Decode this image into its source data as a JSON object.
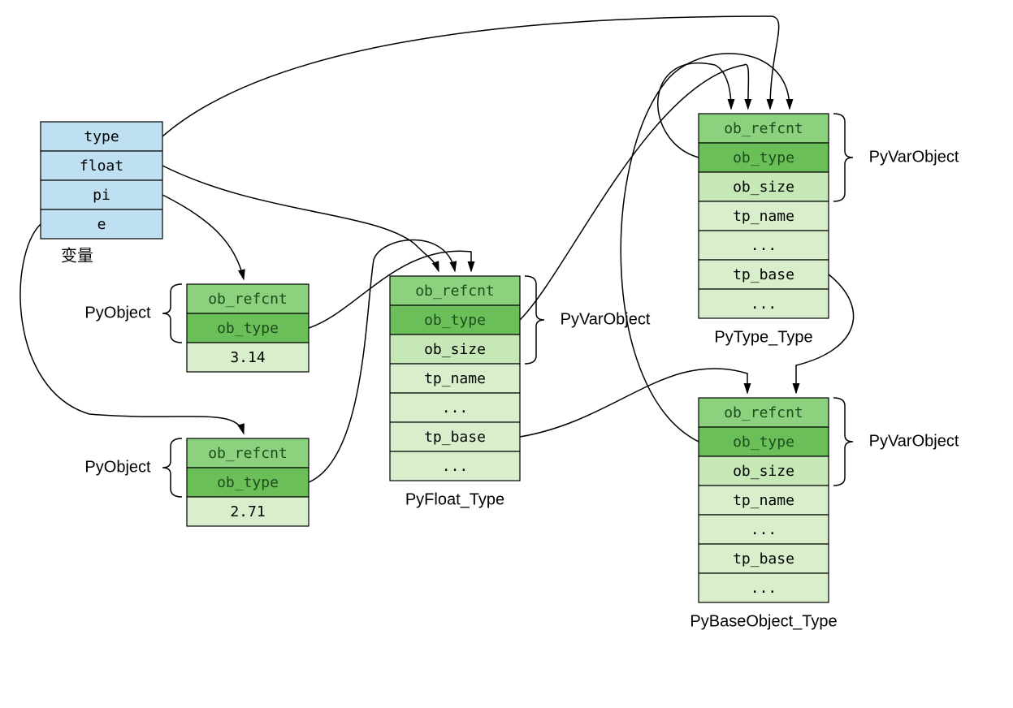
{
  "colors": {
    "blue": "#bfe0f2",
    "greenDark": "#6bbf59",
    "greenMid": "#8cd17d",
    "greenLight": "#c6e8b7",
    "greenPale": "#d9efcc"
  },
  "variables": {
    "title": "变量",
    "rows": [
      "type",
      "float",
      "pi",
      "e"
    ]
  },
  "pi_obj": {
    "rows": [
      "ob_refcnt",
      "ob_type",
      "3.14"
    ],
    "brace_label": "PyObject"
  },
  "e_obj": {
    "rows": [
      "ob_refcnt",
      "ob_type",
      "2.71"
    ],
    "brace_label": "PyObject"
  },
  "pyfloat": {
    "title": "PyFloat_Type",
    "rows": [
      "ob_refcnt",
      "ob_type",
      "ob_size",
      "tp_name",
      "...",
      "tp_base",
      "..."
    ],
    "brace_label": "PyVarObject"
  },
  "pytype": {
    "title": "PyType_Type",
    "rows": [
      "ob_refcnt",
      "ob_type",
      "ob_size",
      "tp_name",
      "...",
      "tp_base",
      "..."
    ],
    "brace_label": "PyVarObject"
  },
  "pybase": {
    "title": "PyBaseObject_Type",
    "rows": [
      "ob_refcnt",
      "ob_type",
      "ob_size",
      "tp_name",
      "...",
      "tp_base",
      "..."
    ],
    "brace_label": "PyVarObject"
  }
}
